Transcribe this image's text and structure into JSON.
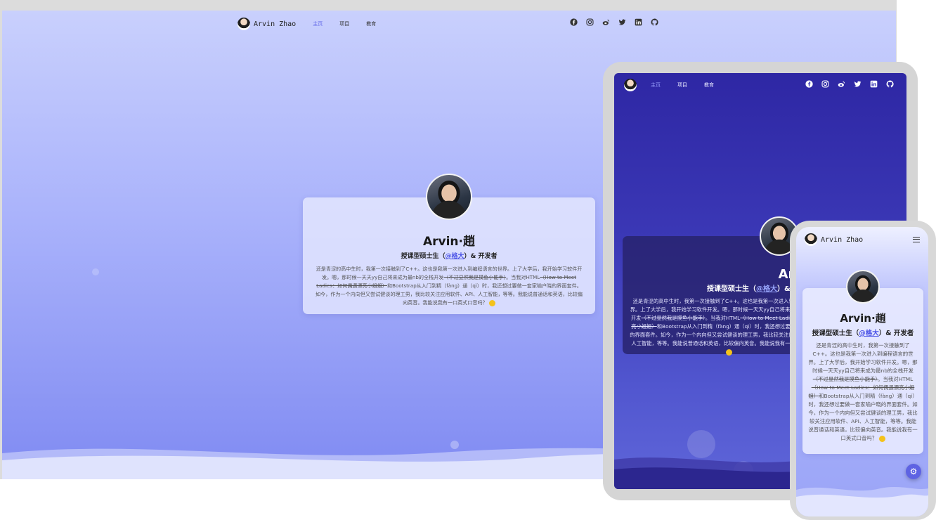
{
  "site": {
    "brand_name": "Arvin Zhao",
    "nav": [
      "主页",
      "项目",
      "教育"
    ],
    "social_icons": [
      "facebook-icon",
      "instagram-icon",
      "weibo-icon",
      "twitter-icon",
      "linkedin-icon",
      "github-icon"
    ]
  },
  "profile": {
    "name": "Arvin·趙",
    "role_prefix": "授课型硕士生（",
    "role_link": "@格大",
    "role_suffix": "）& 开发者",
    "bio_1": "还是青涩的高中生时，我第一次接触到了C++。这也是我第一次进入到编程语言的世界。上了大学后，我开始学习软件开发。嗯，那时候一天天yy自己将来成为最nb的全栈开发",
    "bio_strike_1": "（不过显然我是摸鱼小能手）",
    "bio_2": "。当我对HTML",
    "bio_strike_2": "（How to Meet Ladies：如何偶遇漂亮小姐姐）",
    "bio_3": "和Bootstrap从入门到精（fàng）通（qì）时，我还想过要做一套家喻户晓的界面套件。如今，作为一个内向但又尝试健谈的理工男，我比较关注应用软件、API、人工智能，等等。我能说普通话和英语，比较偏向英音。我能说我有一口英式口音吗？"
  },
  "colors": {
    "accent": "#5b61e8",
    "desktop_bg_top": "#c9d0fd",
    "tablet_bg": "#2e27a4"
  }
}
